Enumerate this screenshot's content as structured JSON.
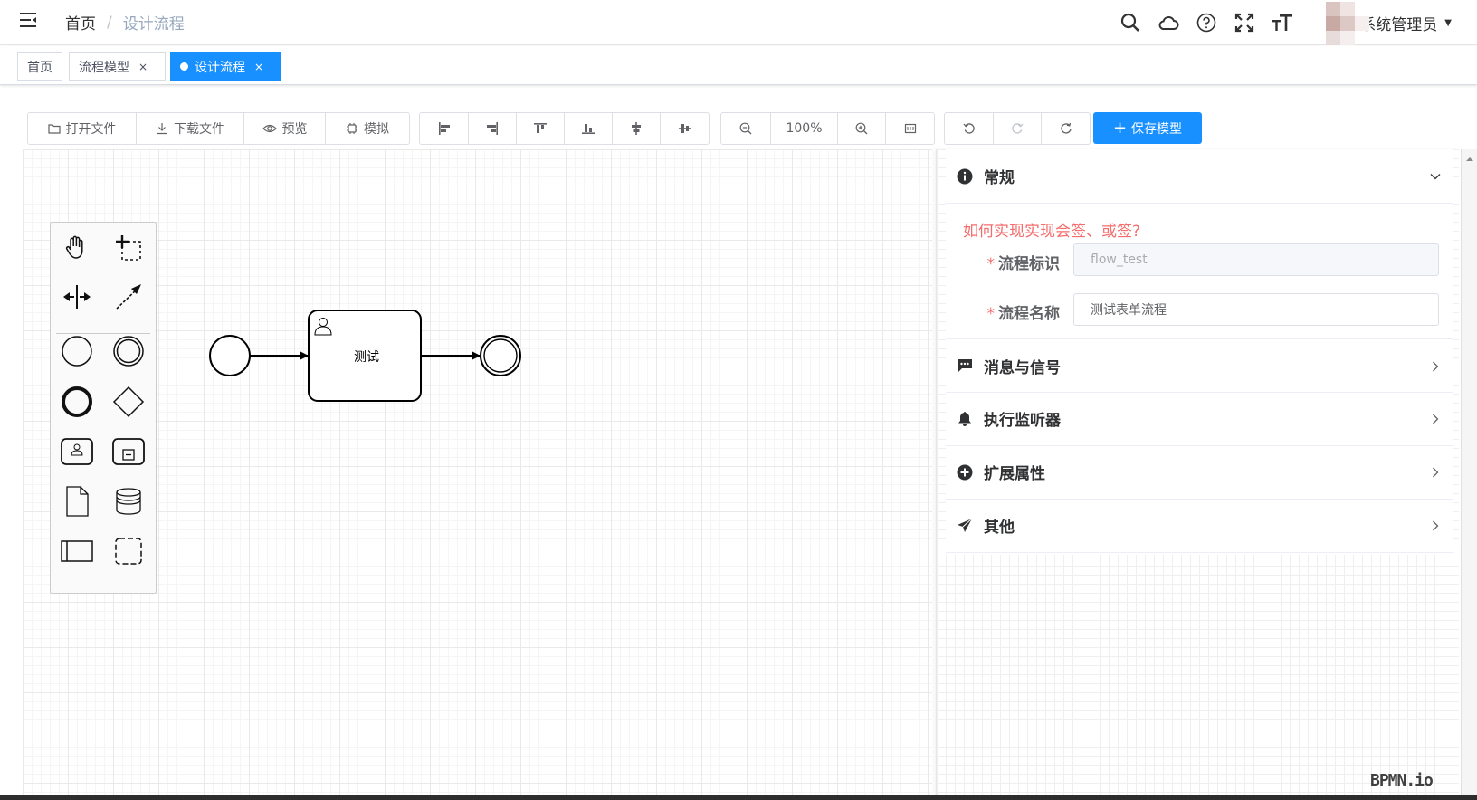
{
  "navbar": {
    "breadcrumb": {
      "home": "首页",
      "separator": "/",
      "current": "设计流程"
    },
    "icons": [
      "search-icon",
      "cloud-icon",
      "help-icon",
      "fullscreen-icon",
      "font-size-icon"
    ],
    "user": {
      "name": "系统管理员"
    }
  },
  "tags": [
    {
      "label": "首页",
      "closable": false,
      "active": false
    },
    {
      "label": "流程模型",
      "closable": true,
      "active": false
    },
    {
      "label": "设计流程",
      "closable": true,
      "active": true
    }
  ],
  "tag_close": "×",
  "toolbar": {
    "file": {
      "open": "打开文件",
      "download": "下载文件",
      "preview": "预览",
      "simulate": "模拟"
    },
    "zoom": {
      "level": "100%"
    },
    "save": {
      "label": "保存模型",
      "plus": "+"
    }
  },
  "colors": {
    "primary": "#1890ff",
    "danger": "#f56c6c"
  },
  "diagram": {
    "task_label": "测试"
  },
  "properties": {
    "general": {
      "title": "常规",
      "question": "如何实现实现会签、或签?"
    },
    "fields": {
      "process_id": {
        "label": "流程标识",
        "value": "flow_test",
        "required_mark": "*"
      },
      "process_name": {
        "label": "流程名称",
        "value": "测试表单流程",
        "required_mark": "*"
      }
    },
    "sections": {
      "message": "消息与信号",
      "listener": "执行监听器",
      "extension": "扩展属性",
      "other": "其他"
    }
  },
  "watermark": "BPMN.io"
}
